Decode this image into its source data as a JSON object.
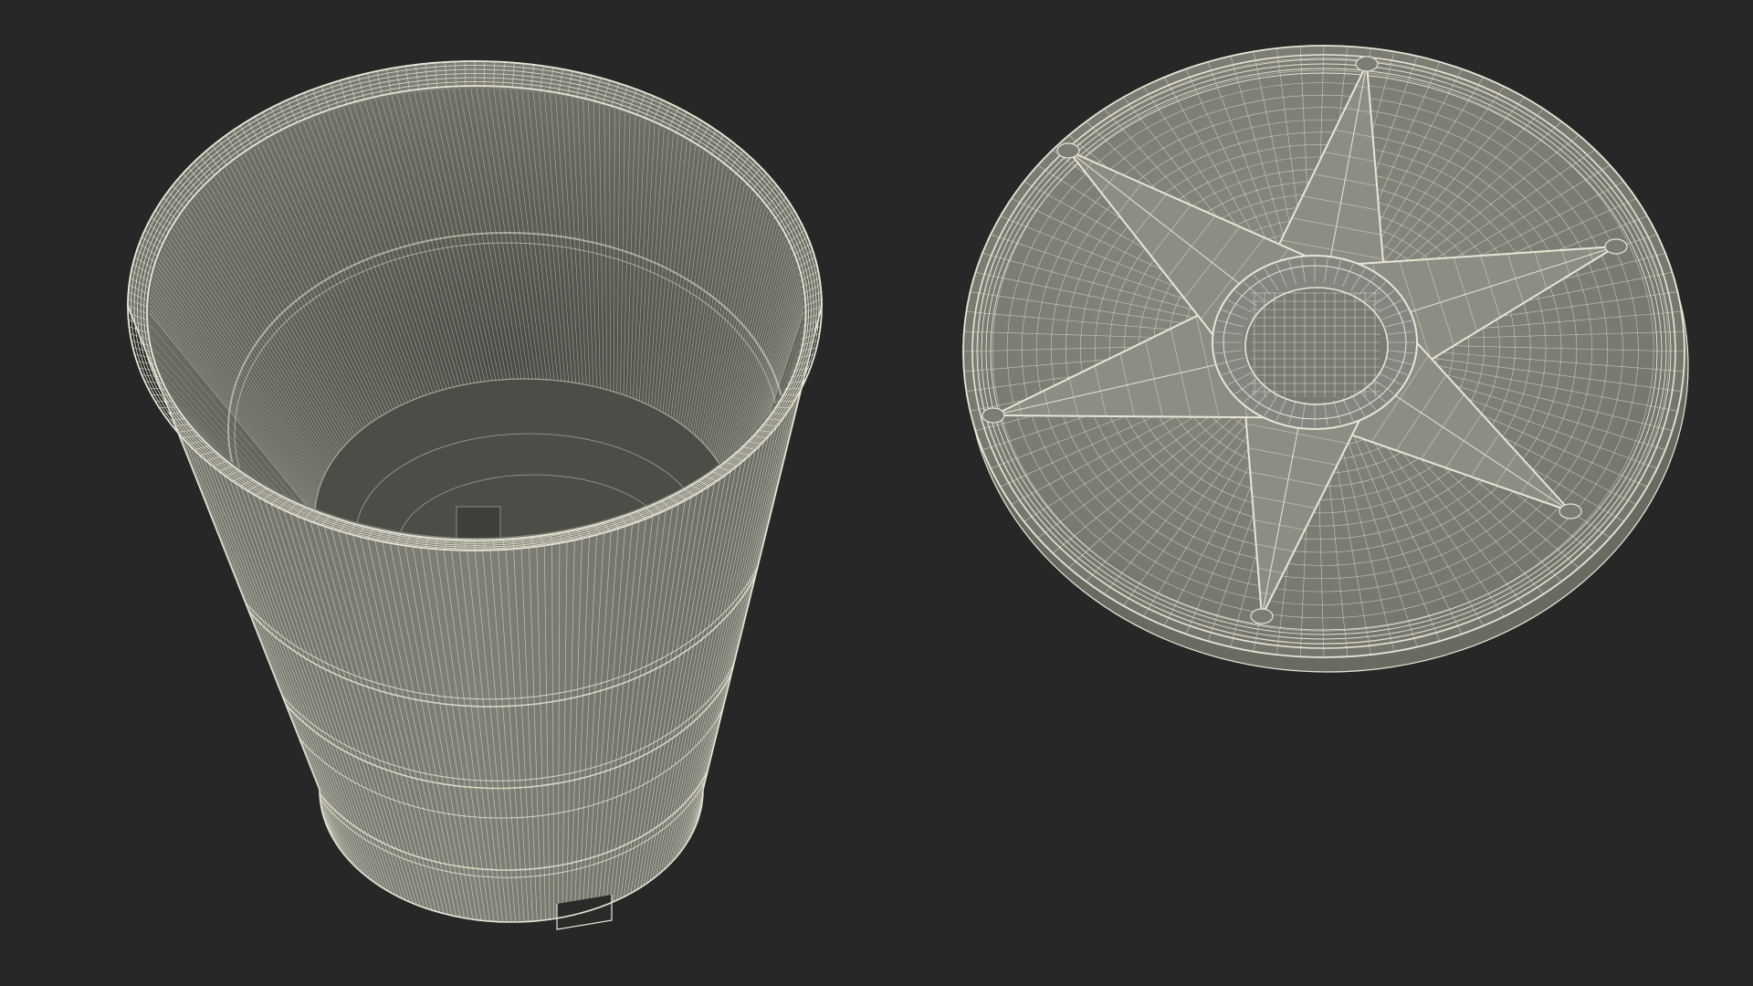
{
  "scene": {
    "background": "#272727",
    "surface_color": "#7a7a72",
    "surface_dark": "#4e4e49",
    "surface_light": "#909087",
    "wire_color": "#e8e6d6",
    "objects": [
      {
        "name": "bucket-model",
        "description_icon": "bucket-wireframe"
      },
      {
        "name": "lid-model",
        "description_icon": "lid-wireframe"
      }
    ]
  }
}
